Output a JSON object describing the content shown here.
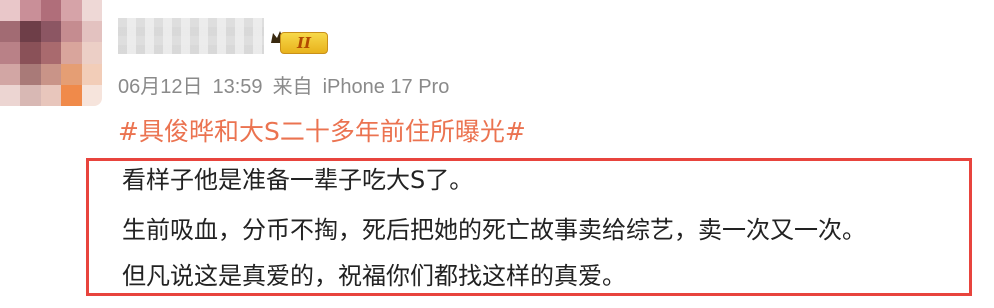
{
  "post": {
    "date": "06月12日",
    "time": "13:59",
    "source_prefix": "来自",
    "device": "iPhone 17 Pro",
    "level_badge": "II",
    "hashtag": "#具俊晔和大S二十多年前住所曝光#",
    "comment_lines": [
      "看样子他是准备一辈子吃大S了。",
      "生前吸血，分币不掏，死后把她的死亡故事卖给综艺，卖一次又一次。",
      "但凡说这是真爱的，祝福你们都找这样的真爱。"
    ]
  },
  "colors": {
    "hashtag": "#eb7350",
    "highlight_border": "#e8443d",
    "meta_text": "#8a8a8a",
    "badge_gold": "#f0c431"
  }
}
